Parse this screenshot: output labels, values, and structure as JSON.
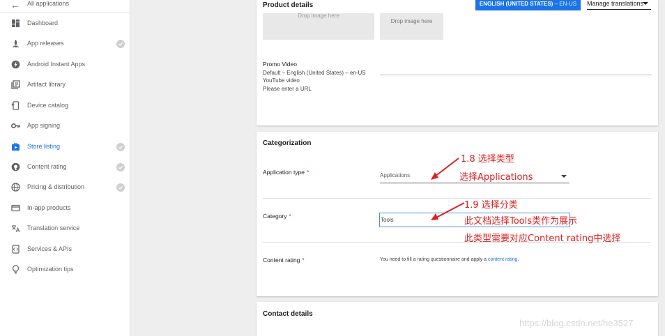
{
  "sidebar": {
    "back_label": "All applications",
    "items": [
      {
        "label": "Dashboard",
        "icon": "dashboard-icon",
        "checked": false,
        "active": false
      },
      {
        "label": "App releases",
        "icon": "rocket-icon",
        "checked": true,
        "active": false
      },
      {
        "label": "Android Instant Apps",
        "icon": "instant-apps-icon",
        "checked": false,
        "active": false
      },
      {
        "label": "Artifact library",
        "icon": "library-icon",
        "checked": false,
        "active": false
      },
      {
        "label": "Device catalog",
        "icon": "device-icon",
        "checked": false,
        "active": false
      },
      {
        "label": "App signing",
        "icon": "key-icon",
        "checked": false,
        "active": false
      },
      {
        "label": "Store listing",
        "icon": "store-icon",
        "checked": true,
        "active": true
      },
      {
        "label": "Content rating",
        "icon": "content-rating-icon",
        "checked": true,
        "active": false
      },
      {
        "label": "Pricing & distribution",
        "icon": "globe-icon",
        "checked": true,
        "active": false
      },
      {
        "label": "In-app products",
        "icon": "card-icon",
        "checked": false,
        "active": false
      },
      {
        "label": "Translation service",
        "icon": "translate-icon",
        "checked": false,
        "active": false
      },
      {
        "label": "Services & APIs",
        "icon": "api-icon",
        "checked": false,
        "active": false
      },
      {
        "label": "Optimization tips",
        "icon": "lightbulb-icon",
        "checked": false,
        "active": false
      }
    ]
  },
  "header": {
    "product_details": "Product details",
    "lang_button": "ENGLISH (UNITED STATES)",
    "lang_button_sub": "– EN-US",
    "manage_translations": "Manage translations"
  },
  "product_details": {
    "drop_image_1": "Drop image here",
    "drop_image_2": "Drop image here",
    "promo_title": "Promo Video",
    "promo_line1": "Default – English (United States) – en-US",
    "promo_line2": "YouTube video",
    "promo_line3": "Please enter a URL"
  },
  "categorization": {
    "title": "Categorization",
    "app_type_label": "Application type",
    "app_type_value": "Applications",
    "category_label": "Category",
    "category_value": "Tools",
    "content_rating_label": "Content rating",
    "required_mark": "*",
    "content_rating_text": "You need to fill a rating questionnaire and apply a ",
    "content_rating_link": "content rating",
    "content_rating_end": "."
  },
  "contact": {
    "title": "Contact details"
  },
  "annotations": {
    "a1": "1.8 选择类型",
    "a2": "选择Applications",
    "a3": "1.9 选择分类",
    "a4": "此文档选择Tools类作为展示",
    "a5": "此类型需要对应Content rating中选择"
  },
  "watermark": "https://blog.csdn.net/he3527",
  "colors": {
    "accent": "#1a73e8",
    "annotation": "#e02020",
    "required": "#d93025"
  }
}
